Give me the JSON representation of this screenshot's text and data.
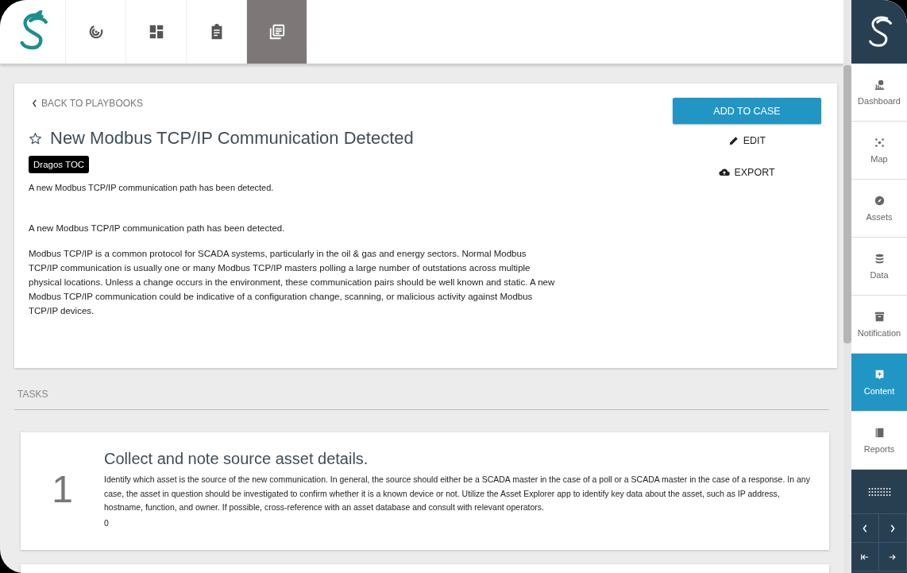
{
  "top_tabs": [
    {
      "selected": false
    },
    {
      "selected": false
    },
    {
      "selected": false
    },
    {
      "selected": true
    }
  ],
  "sidebar": {
    "items": [
      {
        "label": "Dashboard",
        "selected": false
      },
      {
        "label": "Map",
        "selected": false
      },
      {
        "label": "Assets",
        "selected": false
      },
      {
        "label": "Data",
        "selected": false
      },
      {
        "label": "Notification",
        "selected": false
      },
      {
        "label": "Content",
        "selected": true
      },
      {
        "label": "Reports",
        "selected": false
      }
    ]
  },
  "playbook": {
    "back_link": "BACK TO PLAYBOOKS",
    "starred": false,
    "title": "New Modbus TCP/IP Communication Detected",
    "tag": "Dragos TOC",
    "actions": {
      "add_to_case": "ADD TO CASE",
      "edit": "EDIT",
      "export": "EXPORT"
    },
    "summary": "A new Modbus TCP/IP communication path has been detected.",
    "description": [
      "A new Modbus TCP/IP communication path has been detected.",
      "Modbus TCP/IP is a common protocol for SCADA systems, particularly in the oil & gas and energy sectors. Normal Modbus TCP/IP communication is usually one or many Modbus TCP/IP masters polling a large number of outstations across multiple physical locations. Unless a change occurs in the environment, these communication pairs should be well known and static. A new Modbus TCP/IP communication could be indicative of a configuration change, scanning, or malicious activity against Modbus TCP/IP devices."
    ]
  },
  "tasks_label": "TASKS",
  "tasks": [
    {
      "number": "1",
      "title": "Collect and note source asset details.",
      "body": "Identify which asset is the source of the new communication. In general, the source should either be a SCADA master in the case of a poll or a SCADA master in the case of a response. In any case, the asset in question should be investigated to confirm whether it is a known device or not. Utilize the Asset Explorer app to identify key data about the asset, such as IP address, hostname, function, and owner. If possible, cross-reference with an asset database and consult with relevant operators.",
      "footer": "0"
    }
  ]
}
